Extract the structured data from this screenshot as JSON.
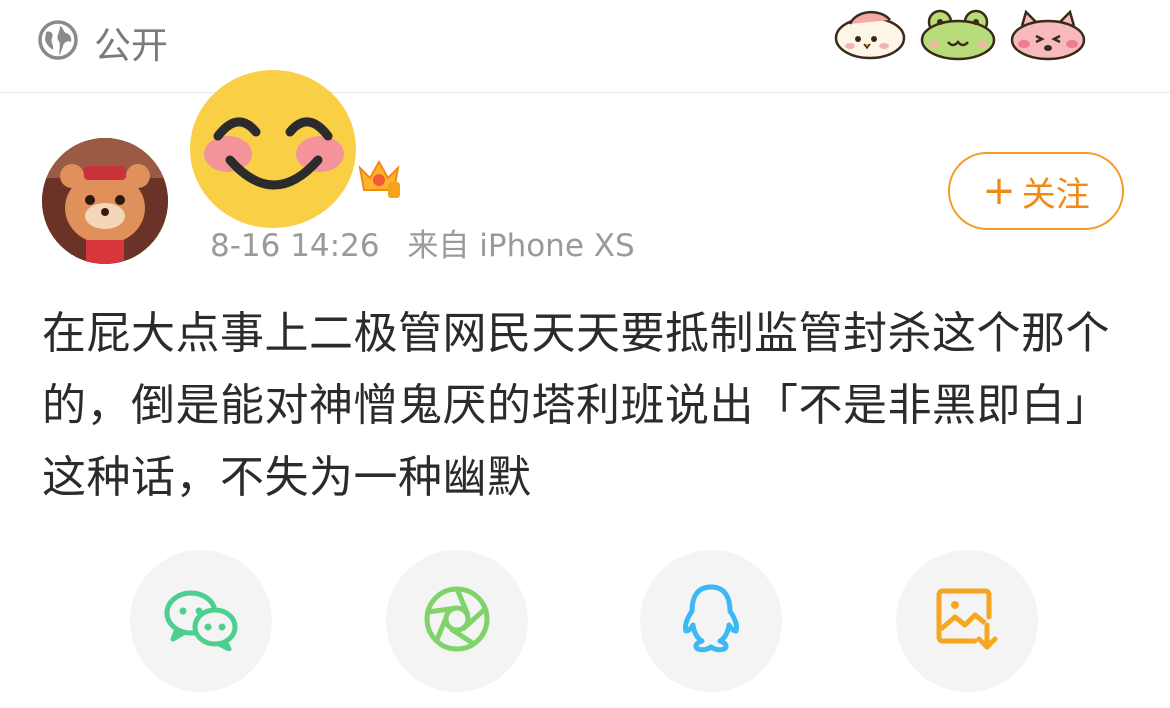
{
  "header": {
    "visibility_label": "公开",
    "visibility_icon": "globe-icon",
    "sticker_icons": [
      "chick-sticker-icon",
      "frog-sticker-icon",
      "pig-sticker-icon"
    ]
  },
  "post": {
    "timestamp": "8-16 14:26",
    "source": "来自 iPhone XS",
    "follow_label": "关注",
    "follow_icon": "plus-icon",
    "content": "在屁大点事上二极管网民天天要抵制监管封杀这个那个的，倒是能对神憎鬼厌的塔利班说出「不是非黑即白」这种话，不失为一种幽默"
  },
  "share": {
    "targets": [
      "wechat-icon",
      "moments-icon",
      "qq-icon",
      "save-image-icon"
    ]
  },
  "colors": {
    "accent": "#f59b23",
    "wechat": "#4dcf8f",
    "moments": "#7fd36a",
    "qq": "#3db8f5",
    "save": "#f5a623"
  }
}
